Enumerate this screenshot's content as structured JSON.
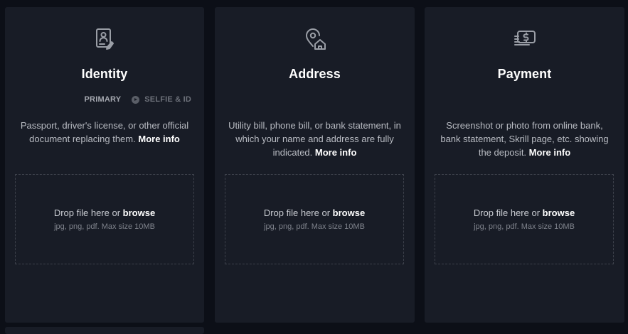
{
  "cards": [
    {
      "icon": "id-card-icon",
      "title": "Identity",
      "subtab_primary": "PRIMARY",
      "subtab_secondary": "SELFIE & ID",
      "description": "Passport, driver's license, or other official document replacing them.",
      "more_info": "More info",
      "drop_prefix": "Drop file here or ",
      "browse": "browse",
      "drop_hint": "jpg, png, pdf. Max size 10MB"
    },
    {
      "icon": "location-home-icon",
      "title": "Address",
      "description": "Utility bill, phone bill, or bank statement, in which your name and address are fully indicated.",
      "more_info": "More info",
      "drop_prefix": "Drop file here or ",
      "browse": "browse",
      "drop_hint": "jpg, png, pdf. Max size 10MB"
    },
    {
      "icon": "payment-icon",
      "title": "Payment",
      "description": "Screenshot or photo from online bank, bank statement, Skrill page, etc. showing the deposit.",
      "more_info": "More info",
      "drop_prefix": "Drop file here or ",
      "browse": "browse",
      "drop_hint": "jpg, png, pdf. Max size 10MB"
    }
  ],
  "colors": {
    "page_bg": "#0c0f17",
    "card_bg": "#181c26",
    "icon": "#9a9ea6",
    "title": "#ffffff",
    "text": "#b9bcc3"
  }
}
